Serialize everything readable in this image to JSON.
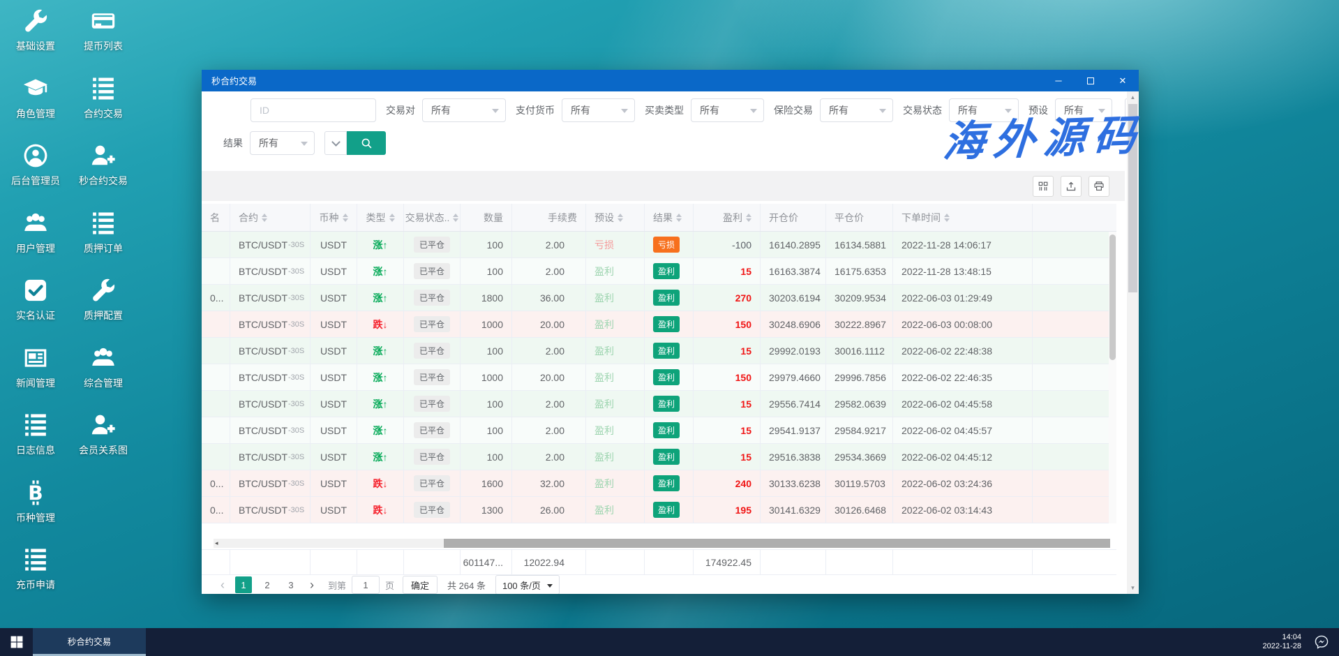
{
  "desktop": {
    "icons": [
      {
        "label": "基础设置",
        "icon": "wrench"
      },
      {
        "label": "提币列表",
        "icon": "card"
      },
      {
        "label": "角色管理",
        "icon": "cap"
      },
      {
        "label": "合约交易",
        "icon": "list"
      },
      {
        "label": "后台管理员",
        "icon": "user-circle"
      },
      {
        "label": "秒合约交易",
        "icon": "user-add"
      },
      {
        "label": "用户管理",
        "icon": "users"
      },
      {
        "label": "质押订单",
        "icon": "list"
      },
      {
        "label": "实名认证",
        "icon": "check"
      },
      {
        "label": "质押配置",
        "icon": "wrench"
      },
      {
        "label": "新闻管理",
        "icon": "news"
      },
      {
        "label": "综合管理",
        "icon": "users"
      },
      {
        "label": "日志信息",
        "icon": "list"
      },
      {
        "label": "会员关系图",
        "icon": "user-add"
      },
      {
        "label": "币种管理",
        "icon": "bitcoin"
      },
      {
        "label": "充币申请",
        "icon": "list"
      }
    ]
  },
  "watermark": "海外源码",
  "icons": {
    "minimize": "─",
    "maximize": "□",
    "close": "✕",
    "gear": "⚙",
    "prev": "‹",
    "next": "›",
    "scroll_up": "▲",
    "scroll_down": "▼",
    "hscroll_left": "◂"
  },
  "window": {
    "title": "秒合约交易",
    "filters": {
      "id_placeholder": "ID",
      "selects": [
        {
          "label": "交易对",
          "value": "所有"
        },
        {
          "label": "支付货币",
          "value": "所有"
        },
        {
          "label": "买卖类型",
          "value": "所有"
        },
        {
          "label": "保险交易",
          "value": "所有"
        },
        {
          "label": "交易状态",
          "value": "所有"
        },
        {
          "label": "预设",
          "value": "所有"
        }
      ],
      "result_label": "结果",
      "result_value": "所有"
    },
    "table": {
      "headers": [
        {
          "label": "名",
          "sortable": false
        },
        {
          "label": "合约",
          "sortable": true
        },
        {
          "label": "币种",
          "sortable": true
        },
        {
          "label": "类型",
          "sortable": true
        },
        {
          "label": "交易状态..",
          "sortable": true
        },
        {
          "label": "数量",
          "sortable": false
        },
        {
          "label": "手续费",
          "sortable": false
        },
        {
          "label": "预设",
          "sortable": true
        },
        {
          "label": "结果",
          "sortable": true
        },
        {
          "label": "盈利",
          "sortable": true
        },
        {
          "label": "开仓价",
          "sortable": false
        },
        {
          "label": "平仓价",
          "sortable": false
        },
        {
          "label": "下单时间",
          "sortable": true
        }
      ],
      "rows": [
        {
          "user": "",
          "contract": "BTC/USDT",
          "spec": "-30S",
          "coin": "USDT",
          "dir": "up",
          "type": "涨↑",
          "status": "已平仓",
          "qty": "100",
          "fee": "2.00",
          "preset": "亏损",
          "result": "亏损",
          "profit": "-100",
          "open": "16140.2895",
          "close": "16134.5881",
          "time": "2022-11-28 14:06:17"
        },
        {
          "user": "",
          "contract": "BTC/USDT",
          "spec": "-30S",
          "coin": "USDT",
          "dir": "up",
          "type": "涨↑",
          "status": "已平仓",
          "qty": "100",
          "fee": "2.00",
          "preset": "盈利",
          "result": "盈利",
          "profit": "15",
          "open": "16163.3874",
          "close": "16175.6353",
          "time": "2022-11-28 13:48:15"
        },
        {
          "user": "0...",
          "contract": "BTC/USDT",
          "spec": "-30S",
          "coin": "USDT",
          "dir": "up",
          "type": "涨↑",
          "status": "已平仓",
          "qty": "1800",
          "fee": "36.00",
          "preset": "盈利",
          "result": "盈利",
          "profit": "270",
          "open": "30203.6194",
          "close": "30209.9534",
          "time": "2022-06-03 01:29:49"
        },
        {
          "user": "",
          "contract": "BTC/USDT",
          "spec": "-30S",
          "coin": "USDT",
          "dir": "down",
          "type": "跌↓",
          "status": "已平仓",
          "qty": "1000",
          "fee": "20.00",
          "preset": "盈利",
          "result": "盈利",
          "profit": "150",
          "open": "30248.6906",
          "close": "30222.8967",
          "time": "2022-06-03 00:08:00"
        },
        {
          "user": "",
          "contract": "BTC/USDT",
          "spec": "-30S",
          "coin": "USDT",
          "dir": "up",
          "type": "涨↑",
          "status": "已平仓",
          "qty": "100",
          "fee": "2.00",
          "preset": "盈利",
          "result": "盈利",
          "profit": "15",
          "open": "29992.0193",
          "close": "30016.1112",
          "time": "2022-06-02 22:48:38"
        },
        {
          "user": "",
          "contract": "BTC/USDT",
          "spec": "-30S",
          "coin": "USDT",
          "dir": "up",
          "type": "涨↑",
          "status": "已平仓",
          "qty": "1000",
          "fee": "20.00",
          "preset": "盈利",
          "result": "盈利",
          "profit": "150",
          "open": "29979.4660",
          "close": "29996.7856",
          "time": "2022-06-02 22:46:35"
        },
        {
          "user": "",
          "contract": "BTC/USDT",
          "spec": "-30S",
          "coin": "USDT",
          "dir": "up",
          "type": "涨↑",
          "status": "已平仓",
          "qty": "100",
          "fee": "2.00",
          "preset": "盈利",
          "result": "盈利",
          "profit": "15",
          "open": "29556.7414",
          "close": "29582.0639",
          "time": "2022-06-02 04:45:58"
        },
        {
          "user": "",
          "contract": "BTC/USDT",
          "spec": "-30S",
          "coin": "USDT",
          "dir": "up",
          "type": "涨↑",
          "status": "已平仓",
          "qty": "100",
          "fee": "2.00",
          "preset": "盈利",
          "result": "盈利",
          "profit": "15",
          "open": "29541.9137",
          "close": "29584.9217",
          "time": "2022-06-02 04:45:57"
        },
        {
          "user": "",
          "contract": "BTC/USDT",
          "spec": "-30S",
          "coin": "USDT",
          "dir": "up",
          "type": "涨↑",
          "status": "已平仓",
          "qty": "100",
          "fee": "2.00",
          "preset": "盈利",
          "result": "盈利",
          "profit": "15",
          "open": "29516.3838",
          "close": "29534.3669",
          "time": "2022-06-02 04:45:12"
        },
        {
          "user": "0...",
          "contract": "BTC/USDT",
          "spec": "-30S",
          "coin": "USDT",
          "dir": "down",
          "type": "跌↓",
          "status": "已平仓",
          "qty": "1600",
          "fee": "32.00",
          "preset": "盈利",
          "result": "盈利",
          "profit": "240",
          "open": "30133.6238",
          "close": "30119.5703",
          "time": "2022-06-02 03:24:36"
        },
        {
          "user": "0...",
          "contract": "BTC/USDT",
          "spec": "-30S",
          "coin": "USDT",
          "dir": "down",
          "type": "跌↓",
          "status": "已平仓",
          "qty": "1300",
          "fee": "26.00",
          "preset": "盈利",
          "result": "盈利",
          "profit": "195",
          "open": "30141.6329",
          "close": "30126.6468",
          "time": "2022-06-02 03:14:43"
        }
      ],
      "summary": {
        "qty": "601147...",
        "fee": "12022.94",
        "profit": "174922.45"
      }
    },
    "pagination": {
      "pages": [
        "1",
        "2",
        "3"
      ],
      "active": "1",
      "goto_label": "到第",
      "goto_value": "1",
      "page_unit": "页",
      "confirm": "确定",
      "total": "共 264 条",
      "size": "100 条/页"
    }
  },
  "taskbar": {
    "app": "秒合约交易",
    "time": "14:04",
    "date": "2022-11-28"
  }
}
